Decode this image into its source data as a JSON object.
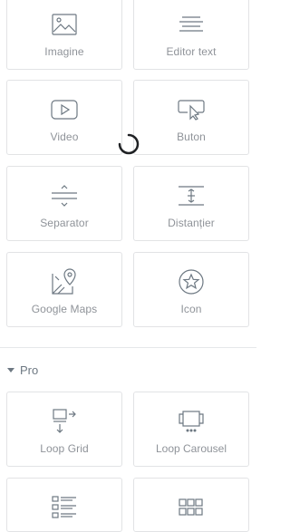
{
  "widgets": {
    "imagine": "Imagine",
    "editor_text": "Editor text",
    "video": "Video",
    "buton": "Buton",
    "separator": "Separator",
    "distantier": "Distanțier",
    "google_maps": "Google Maps",
    "icon": "Icon"
  },
  "pro_section": {
    "title": "Pro",
    "widgets": {
      "loop_grid": "Loop Grid",
      "loop_carousel": "Loop Carousel"
    }
  },
  "icons": {
    "imagine": "image-icon",
    "editor_text": "text-editor-icon",
    "video": "video-play-icon",
    "buton": "button-cursor-icon",
    "separator": "divider-icon",
    "distantier": "spacer-icon",
    "google_maps": "map-pin-icon",
    "icon": "star-circle-icon",
    "loop_grid": "loop-grid-icon",
    "loop_carousel": "loop-carousel-icon",
    "posts": "posts-list-icon",
    "portfolio": "grid-icon"
  },
  "colors": {
    "icon": "#6d7882",
    "label": "#8f9399",
    "border": "#e2e3e5",
    "spinner": "#1f2124"
  }
}
